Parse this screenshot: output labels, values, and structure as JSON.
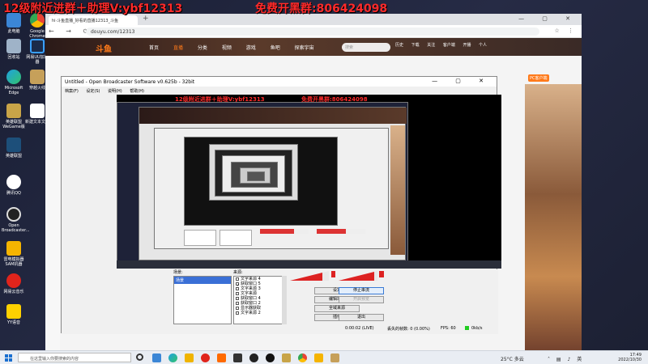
{
  "overlay": {
    "left_text": "12级附近进群＋助理V:ybf12313",
    "right_text": "免费开黑群:806424098"
  },
  "desktop": {
    "icons": [
      "此电脑",
      "Google Chrome",
      "回收站",
      "网易UU加速器",
      "Microsoft Edge",
      "穿越火线",
      "英雄联盟 WeGame版",
      "新建文本文档",
      "英雄联盟",
      "腾讯QQ",
      "Open Broadcaster...",
      "雷电模拟器 SAM机器",
      "网易云音乐",
      "YY语音"
    ]
  },
  "browser": {
    "tab_title": "hi·斗鱼直播_好看的直播12313_斗鱼",
    "url": "douyu.com/12313",
    "site_nav": [
      "首页",
      "直播",
      "分类",
      "视频",
      "游戏",
      "鱼吧",
      "探索宇宙"
    ],
    "site_icons": [
      "历史",
      "下载",
      "关注",
      "客户端",
      "开播",
      "个人"
    ],
    "search_placeholder": "搜索",
    "pc_banner": "PC客户端"
  },
  "obs": {
    "title": "Untitled - Open Broadcaster Software v0.625b - 32bit",
    "menu": [
      "档案(F)",
      "设定(S)",
      "说明(H)",
      "帮助(H)"
    ],
    "overlay_left": "12级附近进群＋助理V:ybf12313",
    "overlay_right": "免费开黑群:806424098",
    "scenes_label": "场景:",
    "sources_label": "来源:",
    "scene_selected": "场景",
    "sources": [
      {
        "label": "文字来源 4",
        "checked": false
      },
      {
        "label": "获取窗口 5",
        "checked": true
      },
      {
        "label": "文字来源 3",
        "checked": false
      },
      {
        "label": "文字来源",
        "checked": false
      },
      {
        "label": "获取窗口 4",
        "checked": true
      },
      {
        "label": "获取窗口 2",
        "checked": true
      },
      {
        "label": "显示器获取",
        "checked": true
      },
      {
        "label": "文字来源 2",
        "checked": false
      }
    ],
    "buttons": {
      "settings": "设定",
      "stop_stream": "停止串流",
      "edit_scene": "编辑场景",
      "preview_stream": "开启预览",
      "global_sources": "全域来源",
      "plugins": "插件",
      "exit": "退出"
    },
    "status": {
      "time": "0:00:02 (LIVE)",
      "dropped": "丢失的帧数: 0 (0.00%)",
      "fps": "FPS: 60",
      "bitrate": "0kb/s"
    }
  },
  "taskbar": {
    "search_placeholder": "在这里输入你要搜索的内容",
    "weather": "25°C 多云",
    "tray": "英",
    "time": "17:49",
    "date": "2022/10/30"
  },
  "colors": {
    "overlay_red": "#ff2a2a",
    "obs_scene_highlight": "#3a6fd6",
    "douyu_orange": "#ff7a1a"
  }
}
